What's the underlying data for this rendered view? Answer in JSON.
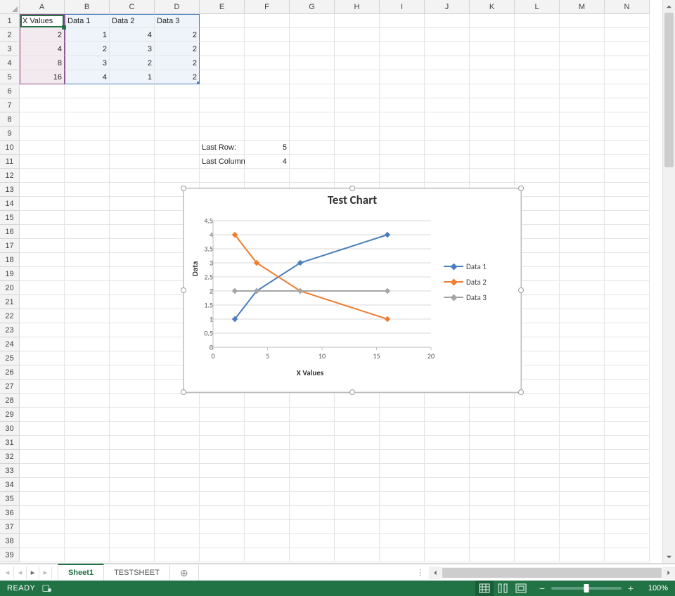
{
  "grid": {
    "columns": [
      "A",
      "B",
      "C",
      "D",
      "E",
      "F",
      "G",
      "H",
      "I",
      "J",
      "K",
      "L",
      "M",
      "N"
    ],
    "row_count": 39,
    "headers": {
      "A1": "X Values",
      "B1": "Data 1",
      "C1": "Data 2",
      "D1": "Data 3"
    },
    "data": {
      "A2": "2",
      "A3": "4",
      "A4": "8",
      "A5": "16",
      "B2": "1",
      "B3": "2",
      "B4": "3",
      "B5": "4",
      "C2": "4",
      "C3": "3",
      "C4": "2",
      "C5": "1",
      "D2": "2",
      "D3": "2",
      "D4": "2",
      "D5": "2",
      "E10": "Last Row:",
      "F10": "5",
      "E11": "Last Column:",
      "F11": "4"
    }
  },
  "selection": {
    "active": "A1",
    "primary": {
      "cols": [
        "A"
      ],
      "rows": [
        1,
        2,
        3,
        4,
        5
      ]
    },
    "secondary": {
      "cols": [
        "B",
        "C",
        "D"
      ],
      "rows": [
        1,
        2,
        3,
        4,
        5
      ]
    }
  },
  "chart_data": {
    "type": "line",
    "title": "Test Chart",
    "xlabel": "X Values",
    "ylabel": "Data",
    "x": [
      2,
      4,
      8,
      16
    ],
    "series": [
      {
        "name": "Data 1",
        "values": [
          1,
          2,
          3,
          4
        ],
        "color": "#4a7ebb"
      },
      {
        "name": "Data 2",
        "values": [
          4,
          3,
          2,
          1
        ],
        "color": "#ed7d31"
      },
      {
        "name": "Data 3",
        "values": [
          2,
          2,
          2,
          2
        ],
        "color": "#a5a5a5"
      }
    ],
    "xlim": [
      0,
      20
    ],
    "xticks": [
      0,
      5,
      10,
      15,
      20
    ],
    "ylim": [
      0,
      4.5
    ],
    "yticks": [
      0,
      0.5,
      1,
      1.5,
      2,
      2.5,
      3,
      3.5,
      4,
      4.5
    ],
    "grid": "horizontal"
  },
  "tabs": {
    "items": [
      "Sheet1",
      "TESTSHEET"
    ],
    "active": 0,
    "add_label": "⊕"
  },
  "status": {
    "ready": "READY",
    "zoom": "100%"
  }
}
